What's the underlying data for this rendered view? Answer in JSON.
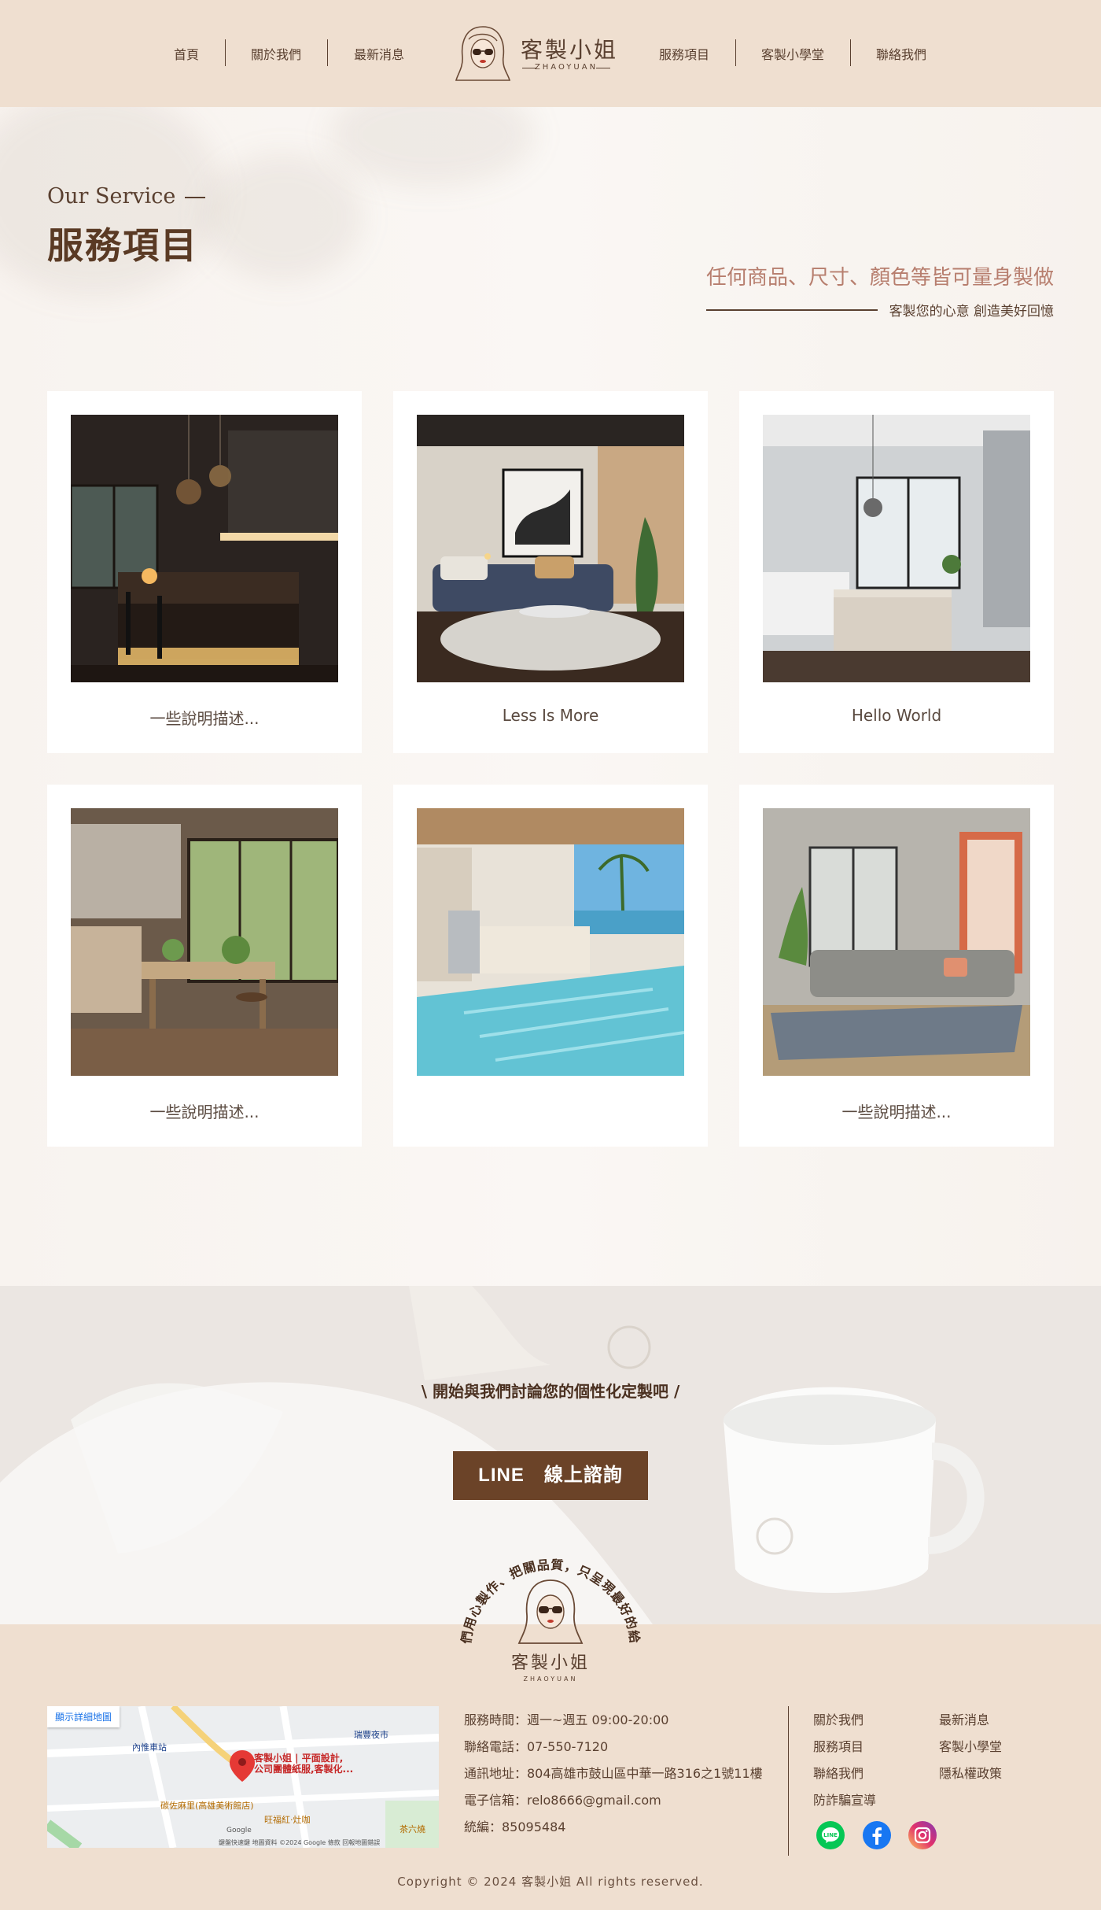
{
  "nav": {
    "left": [
      "首頁",
      "關於我們",
      "最新消息"
    ],
    "right": [
      "服務項目",
      "客製小學堂",
      "聯絡我們"
    ]
  },
  "logo": {
    "name": "客製小姐",
    "sub": "ZHAOYUAN"
  },
  "section": {
    "en_title": "Our Service",
    "title": "服務項目",
    "tagline": "任何商品、尺寸、顏色等皆可量身製做",
    "tagline_sub": "客製您的心意 創造美好回憶"
  },
  "cards": [
    {
      "caption": "一些說明描述...",
      "image": "dark-kitchen-photo"
    },
    {
      "caption": "Less Is More",
      "image": "living-room-photo"
    },
    {
      "caption": "Hello World",
      "image": "modern-kitchen-photo"
    },
    {
      "caption": "一些說明描述...",
      "image": "rustic-kitchen-photo"
    },
    {
      "caption": "",
      "image": "pool-kitchen-photo"
    },
    {
      "caption": "一些說明描述...",
      "image": "lounge-photo"
    }
  ],
  "cta": {
    "text": "\\ 開始與我們討論您的個性化定製吧 /",
    "button": "LINE　線上諮詢"
  },
  "footer": {
    "badge_arc": "我們用心製作、把關品質，只呈現最好的給你",
    "info": [
      "服務時間：週一~週五 09:00-20:00",
      "聯絡電話：07-550-7120",
      "通訊地址：804高雄市鼓山區中華一路316之1號11樓",
      "電子信箱：relo8666@gmail.com",
      "統編：85095484"
    ],
    "links_col1": [
      "關於我們",
      "服務項目",
      "聯絡我們",
      "防詐騙宣導"
    ],
    "links_col2": [
      "最新消息",
      "客製小學堂",
      "隱私權政策"
    ],
    "social": [
      "line-icon",
      "facebook-icon",
      "instagram-icon"
    ],
    "copyright": "Copyright © 2024 客製小姐 All rights reserved."
  },
  "map": {
    "button": "顯示詳細地圖",
    "marker": "客製小姐 | 平面設計,",
    "marker2": "公司團體紙服,客製化...",
    "labels": [
      "內惟車站",
      "瑞豐夜市",
      "旺福紅·灶咖",
      "碳佐麻里(高雄美術館店)",
      "茶六燒",
      "Google"
    ],
    "attribution": "鍵盤快速鍵  地圖資料 ©2024 Google  條款  回報地圖錯誤"
  },
  "colors": {
    "header_bg": "#efdfd0",
    "accent": "#6b4328",
    "tagline": "#b77e6e"
  }
}
